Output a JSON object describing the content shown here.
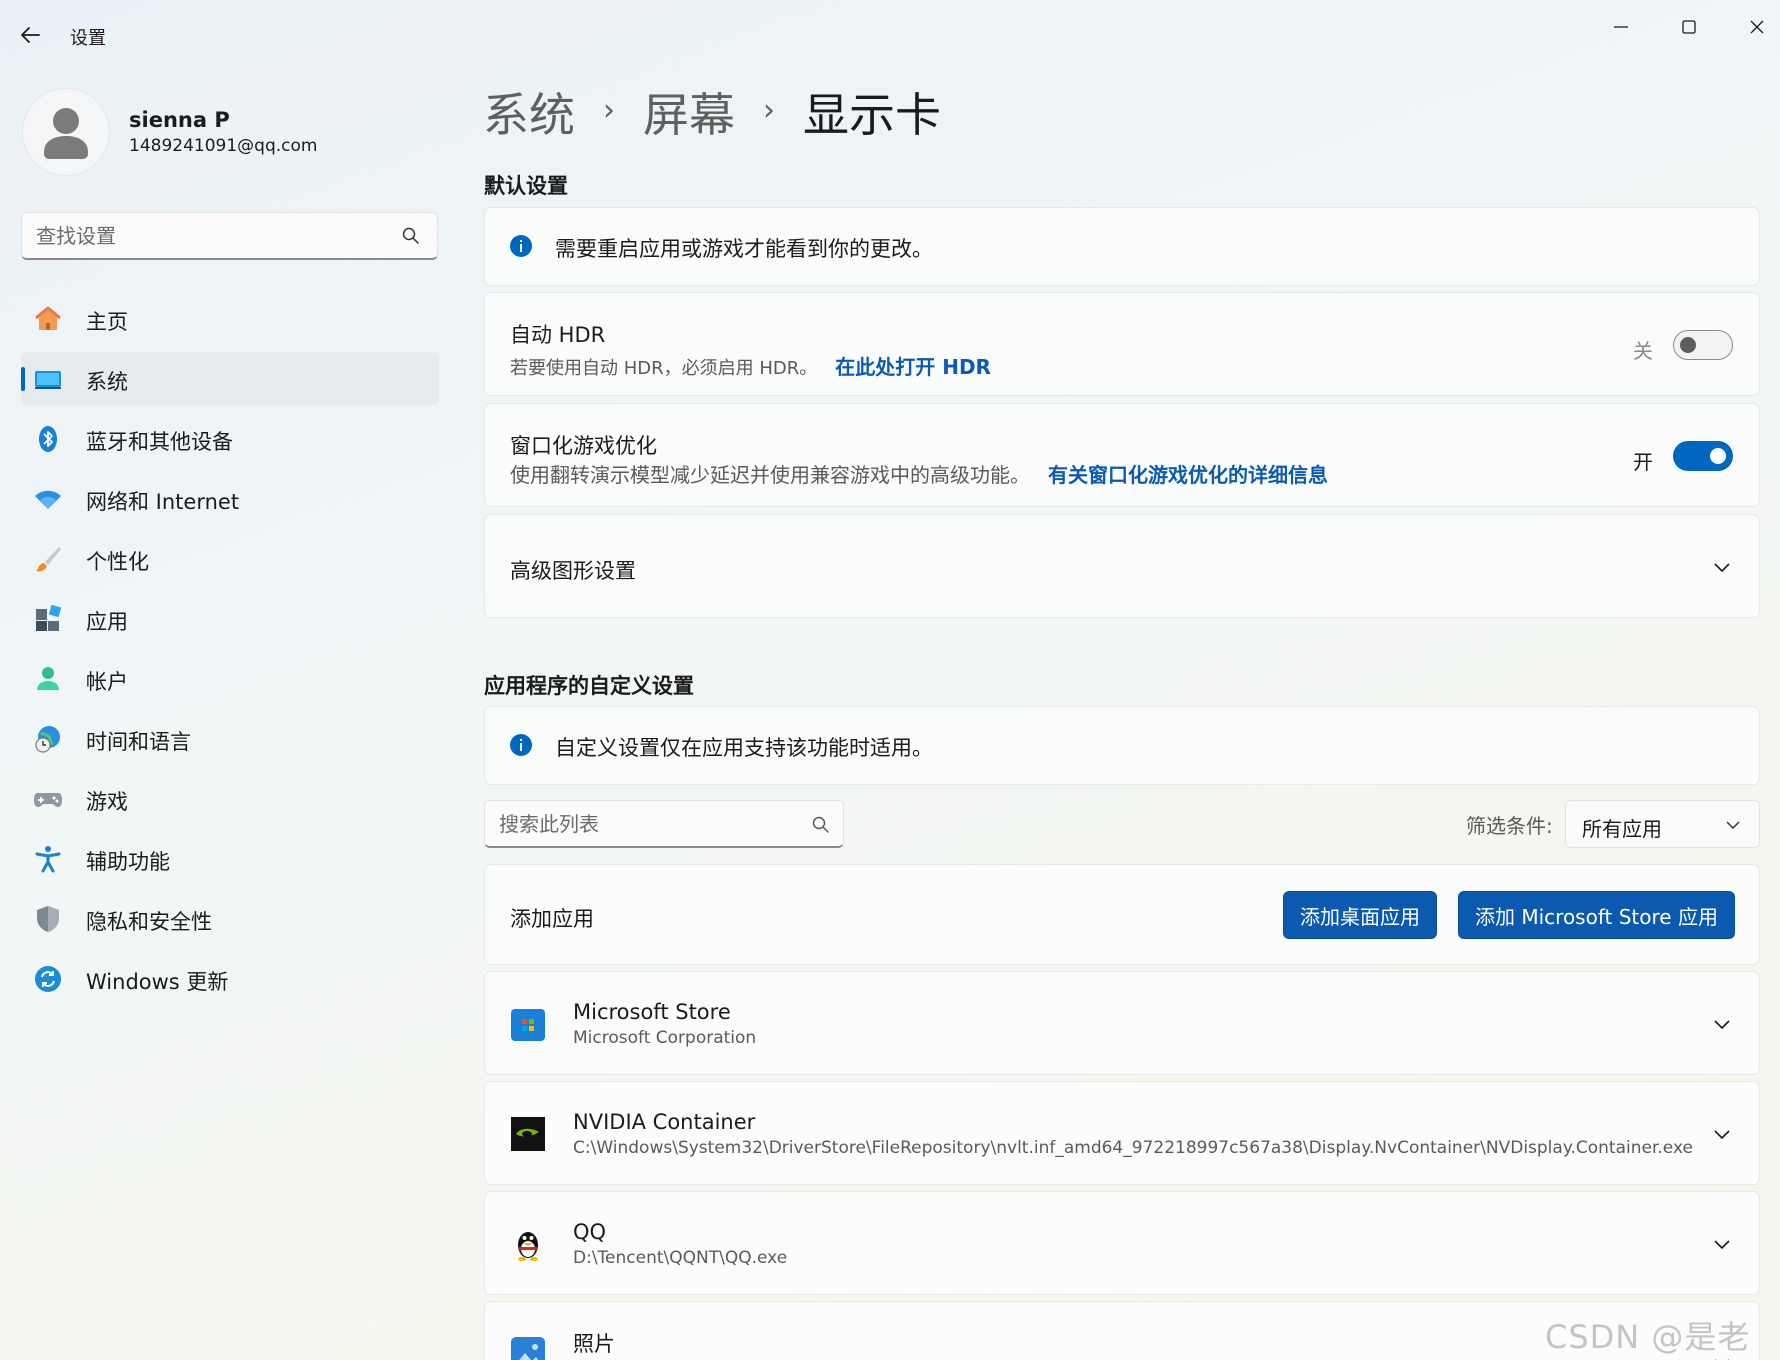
{
  "window": {
    "title": "设置",
    "back": "back-arrow-icon",
    "controls": [
      "minimize-icon",
      "maximize-icon",
      "close-icon"
    ]
  },
  "user": {
    "name": "sienna P",
    "email": "1489241091@qq.com"
  },
  "search": {
    "placeholder": "查找设置"
  },
  "sidebar": {
    "items": [
      {
        "label": "主页",
        "icon": "home-icon"
      },
      {
        "label": "系统",
        "icon": "system-icon",
        "active": true
      },
      {
        "label": "蓝牙和其他设备",
        "icon": "bluetooth-icon"
      },
      {
        "label": "网络和 Internet",
        "icon": "wifi-icon"
      },
      {
        "label": "个性化",
        "icon": "brush-icon"
      },
      {
        "label": "应用",
        "icon": "apps-icon"
      },
      {
        "label": "帐户",
        "icon": "account-icon"
      },
      {
        "label": "时间和语言",
        "icon": "globe-clock-icon"
      },
      {
        "label": "游戏",
        "icon": "gamepad-icon"
      },
      {
        "label": "辅助功能",
        "icon": "accessibility-icon"
      },
      {
        "label": "隐私和安全性",
        "icon": "shield-icon"
      },
      {
        "label": "Windows 更新",
        "icon": "update-icon"
      }
    ]
  },
  "breadcrumb": [
    "系统",
    "屏幕",
    "显示卡"
  ],
  "default_settings": {
    "title": "默认设置",
    "info": "需要重启应用或游戏才能看到你的更改。",
    "auto_hdr": {
      "title": "自动 HDR",
      "desc": "若要使用自动 HDR，必须启用 HDR。",
      "link": "在此处打开 HDR",
      "state_label": "关",
      "on": false
    },
    "windowed_games": {
      "title": "窗口化游戏优化",
      "desc": "使用翻转演示模型减少延迟并使用兼容游戏中的高级功能。",
      "link": "有关窗口化游戏优化的详细信息",
      "state_label": "开",
      "on": true
    },
    "advanced": {
      "title": "高级图形设置"
    }
  },
  "app_settings": {
    "title": "应用程序的自定义设置",
    "info": "自定义设置仅在应用支持该功能时适用。",
    "list_search_placeholder": "搜索此列表",
    "filter_label": "筛选条件:",
    "filter_value": "所有应用",
    "add_app": {
      "label": "添加应用",
      "desktop_button": "添加桌面应用",
      "store_button": "添加 Microsoft Store 应用"
    },
    "apps": [
      {
        "name": "Microsoft Store",
        "sub": "Microsoft Corporation",
        "icon": "microsoft-store-icon"
      },
      {
        "name": "NVIDIA Container",
        "sub": "C:\\Windows\\System32\\DriverStore\\FileRepository\\nvlt.inf_amd64_972218997c567a38\\Display.NvContainer\\NVDisplay.Container.exe",
        "icon": "nvidia-icon"
      },
      {
        "name": "QQ",
        "sub": "D:\\Tencent\\QQNT\\QQ.exe",
        "icon": "qq-penguin-icon"
      },
      {
        "name": "照片",
        "sub": "",
        "icon": "photos-icon"
      }
    ]
  },
  "watermark": "CSDN @是老余",
  "colors": {
    "accent": "#0067c0",
    "link": "#0b5ab0"
  }
}
